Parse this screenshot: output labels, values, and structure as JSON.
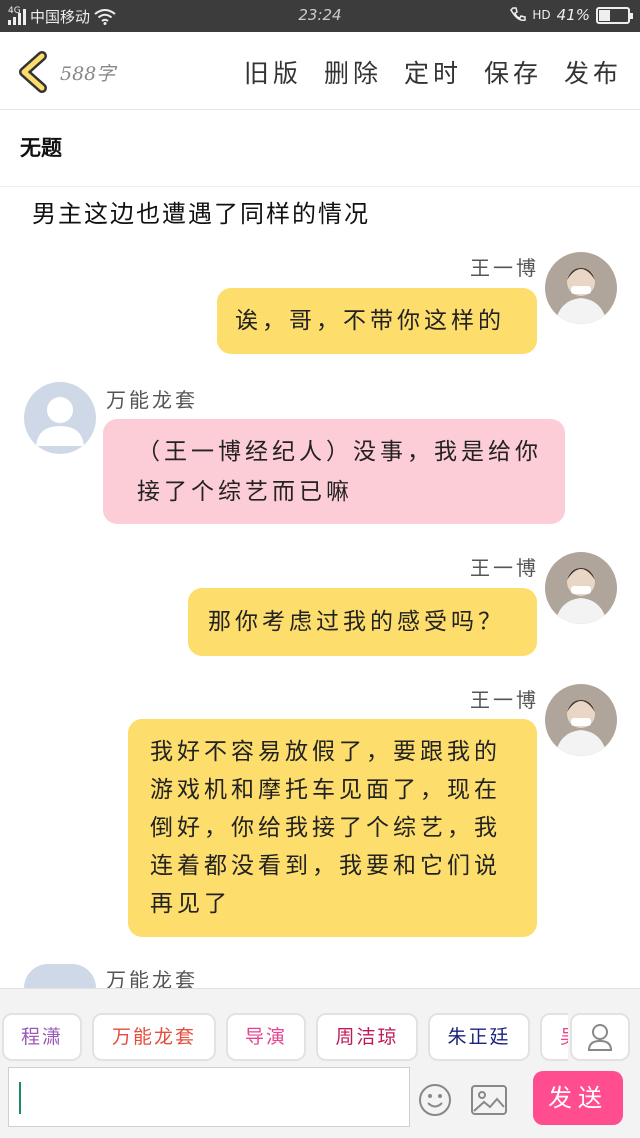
{
  "status_bar": {
    "network": "4G",
    "carrier": "中国移动",
    "time": "23:24",
    "hd": "HD",
    "battery": "41%",
    "battery_level": 0.41
  },
  "header": {
    "word_count": "588字",
    "actions": [
      "旧版",
      "删除",
      "定时",
      "保存",
      "发布"
    ]
  },
  "document": {
    "title": "无题",
    "intro": "男主这边也遭遇了同样的情况"
  },
  "messages": [
    {
      "sender": "王一博",
      "text": "诶，哥，不带你这样的",
      "side": "right",
      "color": "yellow"
    },
    {
      "sender": "万能龙套",
      "text": "（王一博经纪人）没事，我是给你接了个综艺而已嘛",
      "side": "left",
      "color": "pink"
    },
    {
      "sender": "王一博",
      "text": "那你考虑过我的感受吗？",
      "side": "right",
      "color": "yellow"
    },
    {
      "sender": "王一博",
      "text": "我好不容易放假了，要跟我的游戏机和摩托车见面了，现在倒好，你给我接了个综艺，我连着都没看到，我要和它们说再见了",
      "side": "right",
      "color": "yellow"
    },
    {
      "sender": "万能龙套",
      "text": "",
      "side": "left",
      "color": "pink"
    }
  ],
  "roles": [
    {
      "name": "程潇",
      "color": "#9b59b6"
    },
    {
      "name": "万能龙套",
      "color": "#e74c3c"
    },
    {
      "name": "导演",
      "color": "#e84393"
    },
    {
      "name": "周洁琼",
      "color": "#c2185b"
    },
    {
      "name": "朱正廷",
      "color": "#1a237e"
    },
    {
      "name": "吴",
      "color": "#e84393"
    }
  ],
  "composer": {
    "placeholder": "",
    "send_label": "发送"
  },
  "colors": {
    "accent": "#ff4d8f",
    "bubble_yellow": "#fddd6c",
    "bubble_pink": "#fdcdd7"
  },
  "icons": [
    "back-chevron-icon",
    "emoji-icon",
    "image-icon",
    "person-icon",
    "wifi-icon",
    "signal-icon",
    "battery-icon",
    "phone-hd-icon"
  ]
}
